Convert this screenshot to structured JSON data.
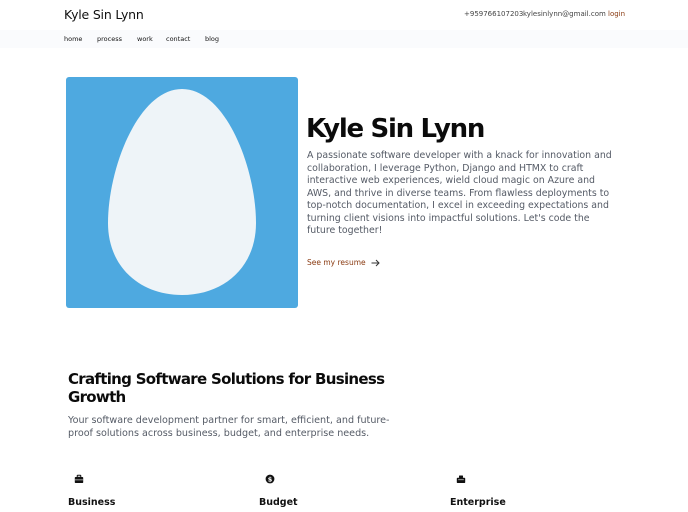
{
  "header": {
    "brand": "Kyle Sin Lynn",
    "phone": "+959766107203",
    "email": "kylesinlynn@gmail.com",
    "login": "login"
  },
  "nav": {
    "items": [
      "home",
      "process",
      "work",
      "contact",
      "blog"
    ]
  },
  "hero": {
    "name": "Kyle Sin Lynn",
    "bio": "A passionate software developer with a knack for innovation and collaboration, I leverage Python, Django and HTMX to craft interactive web experiences, wield cloud magic on Azure and AWS, and thrive in diverse teams. From flawless deployments to top-notch documentation, I excel in exceeding expectations and turning client visions into impactful solutions. Let's code the future together!",
    "resume_link": "See my resume",
    "image_icon": "egg-avatar-placeholder",
    "colors": {
      "image_bg": "#4ea9e0",
      "egg": "#eef4f8",
      "accent": "#8a3b12"
    }
  },
  "services": {
    "title": "Crafting Software Solutions for Business Growth",
    "subtitle": "Your software development partner for smart, efficient, and future-proof solutions across business, budget, and enterprise needs.",
    "items": [
      {
        "title": "Business",
        "icon": "briefcase-icon"
      },
      {
        "title": "Budget",
        "icon": "dollar-coin-icon"
      },
      {
        "title": "Enterprise",
        "icon": "building-icon"
      }
    ]
  }
}
